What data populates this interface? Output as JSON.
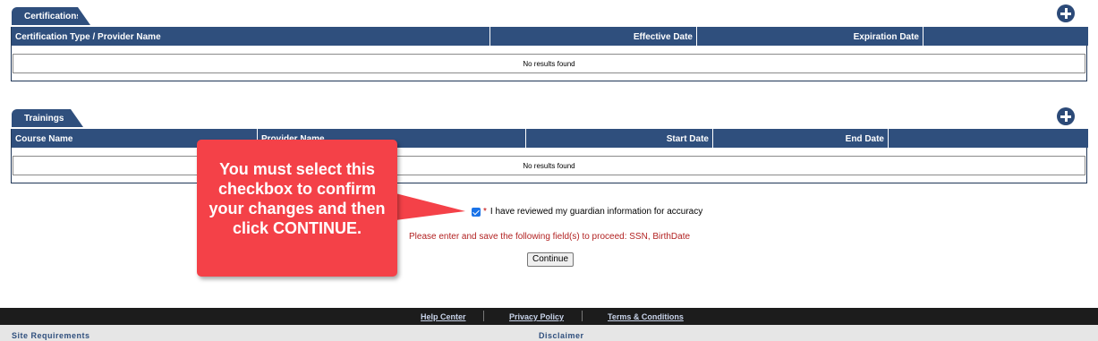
{
  "certifications": {
    "tab_label": "Certifications",
    "columns": [
      "Certification Type / Provider Name",
      "Effective Date",
      "Expiration Date",
      ""
    ],
    "empty_text": "No results found"
  },
  "trainings": {
    "tab_label": "Trainings",
    "columns": [
      "Course Name",
      "Provider Name",
      "Start Date",
      "End Date",
      ""
    ],
    "empty_text": "No results found"
  },
  "confirm": {
    "checked": true,
    "required_marker": "*",
    "label": "I have reviewed my guardian information for accuracy"
  },
  "error_message": "Please enter and save the following field(s) to proceed: SSN, BirthDate",
  "continue_label": "Continue",
  "callout_text": "You must select this checkbox to confirm your changes and then click CONTINUE.",
  "footer": {
    "links": [
      "Help Center",
      "Privacy Policy",
      "Terms & Conditions"
    ],
    "headings": [
      "Site Requirements",
      "Disclaimer"
    ]
  },
  "colors": {
    "header_blue": "#2f4f7d",
    "callout_red": "#f44148",
    "error_red": "#b22222",
    "footer_dark": "#1c1c1c"
  }
}
